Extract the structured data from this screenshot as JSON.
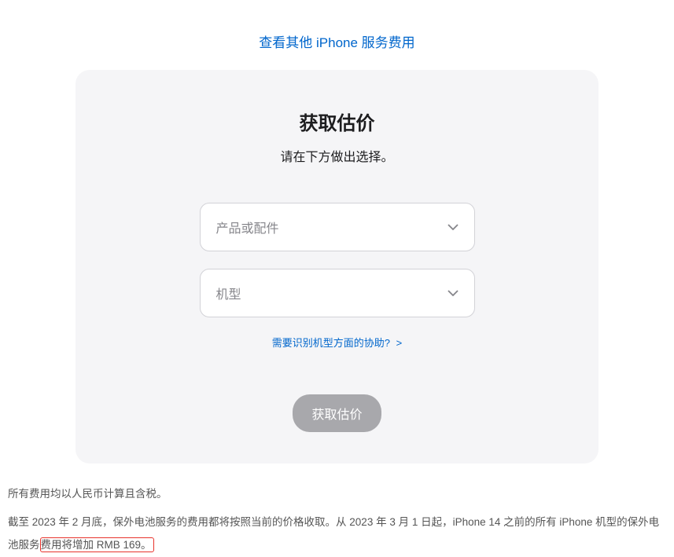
{
  "topLink": {
    "label": "查看其他 iPhone 服务费用"
  },
  "card": {
    "title": "获取估价",
    "subtitle": "请在下方做出选择。",
    "select1": {
      "placeholder": "产品或配件"
    },
    "select2": {
      "placeholder": "机型"
    },
    "helpLink": {
      "label": "需要识别机型方面的协助?",
      "arrow": ">"
    },
    "submit": {
      "label": "获取估价"
    }
  },
  "footer": {
    "line1": "所有费用均以人民币计算且含税。",
    "line2_part1": "截至 2023 年 2 月底，保外电池服务的费用都将按照当前的价格收取。从 2023 年 3 月 1 日起，iPhone 14 之前的所有 iPhone 机型的保外电池服务",
    "line2_highlight": "费用将增加 RMB 169。"
  }
}
